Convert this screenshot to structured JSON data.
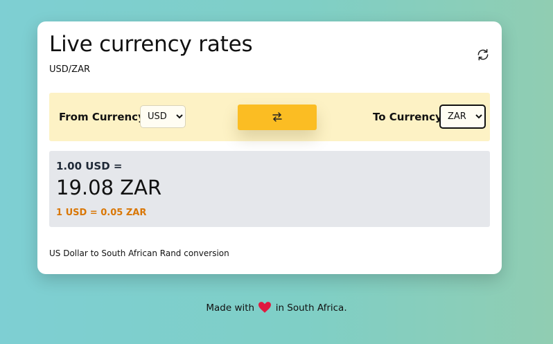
{
  "header": {
    "title": "Live currency rates",
    "pair": "USD/ZAR"
  },
  "icons": {
    "refresh": "refresh-icon",
    "swap": "swap-arrows-icon",
    "heart": "heart-icon"
  },
  "selector": {
    "from_label": "From Currency",
    "from_value": "USD",
    "to_label": "To Currency",
    "to_value": "ZAR"
  },
  "result": {
    "base_line": "1.00 USD =",
    "converted": "19.08 ZAR",
    "inverse": "1 USD = 0.05 ZAR"
  },
  "description": "US Dollar to South African Rand conversion",
  "footer": {
    "prefix": "Made with",
    "suffix": "in South Africa."
  },
  "colors": {
    "selector_bg": "#fdf2c5",
    "swap_button": "#fbbd23",
    "result_bg": "#e5e7eb",
    "inverse_text": "#d97706",
    "heart": "#e0193f"
  }
}
